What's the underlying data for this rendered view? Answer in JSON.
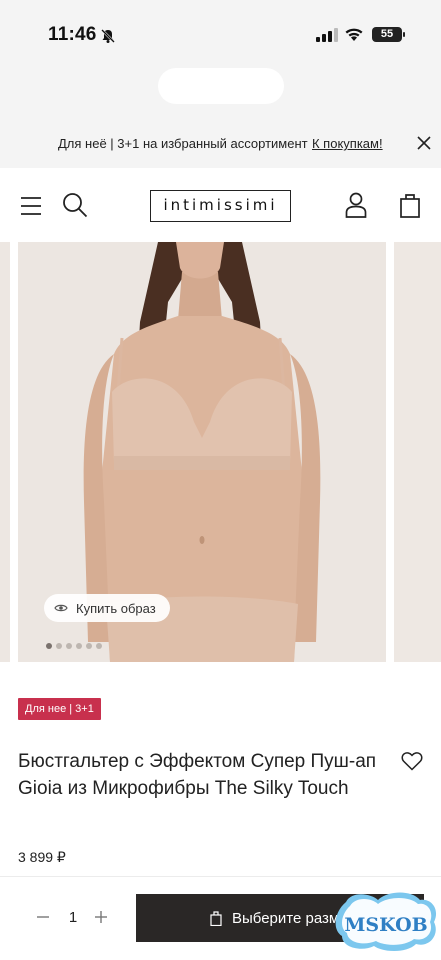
{
  "status_bar": {
    "time": "11:46",
    "battery": "55"
  },
  "promo": {
    "text": "Для неё | 3+1 на избранный ассортимент",
    "link": "К покупкам!"
  },
  "header": {
    "logo": "intimissimi"
  },
  "gallery": {
    "shop_look_label": "Купить образ",
    "slide_count": 6,
    "active_slide": 0
  },
  "product": {
    "badge": "Для нее | 3+1",
    "title": "Бюстгальтер с Эффектом Супер Пуш-ап Gioia из Микрофибры The Silky Touch",
    "price": "3 899 ₽"
  },
  "purchase": {
    "quantity": "1",
    "cta_label": "Выберите размер"
  },
  "watermark": {
    "text": "MSKOB"
  },
  "icons": [
    "bell-slash-icon",
    "signal-icon",
    "wifi-icon",
    "close-icon",
    "menu-icon",
    "search-icon",
    "user-icon",
    "bag-icon",
    "eye-icon",
    "heart-icon",
    "minus-icon",
    "plus-icon"
  ],
  "colors": {
    "badge": "#c8304d",
    "cta_background": "#2a2726",
    "chrome_background": "#f4f4f4"
  }
}
